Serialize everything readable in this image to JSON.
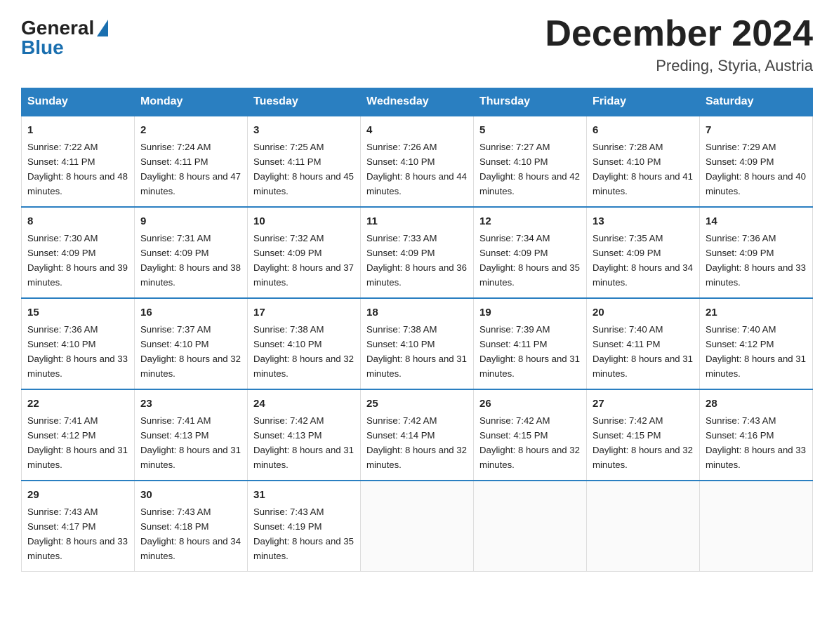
{
  "header": {
    "logo_general": "General",
    "logo_blue": "Blue",
    "month_title": "December 2024",
    "location": "Preding, Styria, Austria"
  },
  "weekdays": [
    "Sunday",
    "Monday",
    "Tuesday",
    "Wednesday",
    "Thursday",
    "Friday",
    "Saturday"
  ],
  "weeks": [
    [
      {
        "day": "1",
        "sunrise": "7:22 AM",
        "sunset": "4:11 PM",
        "daylight": "8 hours and 48 minutes."
      },
      {
        "day": "2",
        "sunrise": "7:24 AM",
        "sunset": "4:11 PM",
        "daylight": "8 hours and 47 minutes."
      },
      {
        "day": "3",
        "sunrise": "7:25 AM",
        "sunset": "4:11 PM",
        "daylight": "8 hours and 45 minutes."
      },
      {
        "day": "4",
        "sunrise": "7:26 AM",
        "sunset": "4:10 PM",
        "daylight": "8 hours and 44 minutes."
      },
      {
        "day": "5",
        "sunrise": "7:27 AM",
        "sunset": "4:10 PM",
        "daylight": "8 hours and 42 minutes."
      },
      {
        "day": "6",
        "sunrise": "7:28 AM",
        "sunset": "4:10 PM",
        "daylight": "8 hours and 41 minutes."
      },
      {
        "day": "7",
        "sunrise": "7:29 AM",
        "sunset": "4:09 PM",
        "daylight": "8 hours and 40 minutes."
      }
    ],
    [
      {
        "day": "8",
        "sunrise": "7:30 AM",
        "sunset": "4:09 PM",
        "daylight": "8 hours and 39 minutes."
      },
      {
        "day": "9",
        "sunrise": "7:31 AM",
        "sunset": "4:09 PM",
        "daylight": "8 hours and 38 minutes."
      },
      {
        "day": "10",
        "sunrise": "7:32 AM",
        "sunset": "4:09 PM",
        "daylight": "8 hours and 37 minutes."
      },
      {
        "day": "11",
        "sunrise": "7:33 AM",
        "sunset": "4:09 PM",
        "daylight": "8 hours and 36 minutes."
      },
      {
        "day": "12",
        "sunrise": "7:34 AM",
        "sunset": "4:09 PM",
        "daylight": "8 hours and 35 minutes."
      },
      {
        "day": "13",
        "sunrise": "7:35 AM",
        "sunset": "4:09 PM",
        "daylight": "8 hours and 34 minutes."
      },
      {
        "day": "14",
        "sunrise": "7:36 AM",
        "sunset": "4:09 PM",
        "daylight": "8 hours and 33 minutes."
      }
    ],
    [
      {
        "day": "15",
        "sunrise": "7:36 AM",
        "sunset": "4:10 PM",
        "daylight": "8 hours and 33 minutes."
      },
      {
        "day": "16",
        "sunrise": "7:37 AM",
        "sunset": "4:10 PM",
        "daylight": "8 hours and 32 minutes."
      },
      {
        "day": "17",
        "sunrise": "7:38 AM",
        "sunset": "4:10 PM",
        "daylight": "8 hours and 32 minutes."
      },
      {
        "day": "18",
        "sunrise": "7:38 AM",
        "sunset": "4:10 PM",
        "daylight": "8 hours and 31 minutes."
      },
      {
        "day": "19",
        "sunrise": "7:39 AM",
        "sunset": "4:11 PM",
        "daylight": "8 hours and 31 minutes."
      },
      {
        "day": "20",
        "sunrise": "7:40 AM",
        "sunset": "4:11 PM",
        "daylight": "8 hours and 31 minutes."
      },
      {
        "day": "21",
        "sunrise": "7:40 AM",
        "sunset": "4:12 PM",
        "daylight": "8 hours and 31 minutes."
      }
    ],
    [
      {
        "day": "22",
        "sunrise": "7:41 AM",
        "sunset": "4:12 PM",
        "daylight": "8 hours and 31 minutes."
      },
      {
        "day": "23",
        "sunrise": "7:41 AM",
        "sunset": "4:13 PM",
        "daylight": "8 hours and 31 minutes."
      },
      {
        "day": "24",
        "sunrise": "7:42 AM",
        "sunset": "4:13 PM",
        "daylight": "8 hours and 31 minutes."
      },
      {
        "day": "25",
        "sunrise": "7:42 AM",
        "sunset": "4:14 PM",
        "daylight": "8 hours and 32 minutes."
      },
      {
        "day": "26",
        "sunrise": "7:42 AM",
        "sunset": "4:15 PM",
        "daylight": "8 hours and 32 minutes."
      },
      {
        "day": "27",
        "sunrise": "7:42 AM",
        "sunset": "4:15 PM",
        "daylight": "8 hours and 32 minutes."
      },
      {
        "day": "28",
        "sunrise": "7:43 AM",
        "sunset": "4:16 PM",
        "daylight": "8 hours and 33 minutes."
      }
    ],
    [
      {
        "day": "29",
        "sunrise": "7:43 AM",
        "sunset": "4:17 PM",
        "daylight": "8 hours and 33 minutes."
      },
      {
        "day": "30",
        "sunrise": "7:43 AM",
        "sunset": "4:18 PM",
        "daylight": "8 hours and 34 minutes."
      },
      {
        "day": "31",
        "sunrise": "7:43 AM",
        "sunset": "4:19 PM",
        "daylight": "8 hours and 35 minutes."
      },
      null,
      null,
      null,
      null
    ]
  ]
}
